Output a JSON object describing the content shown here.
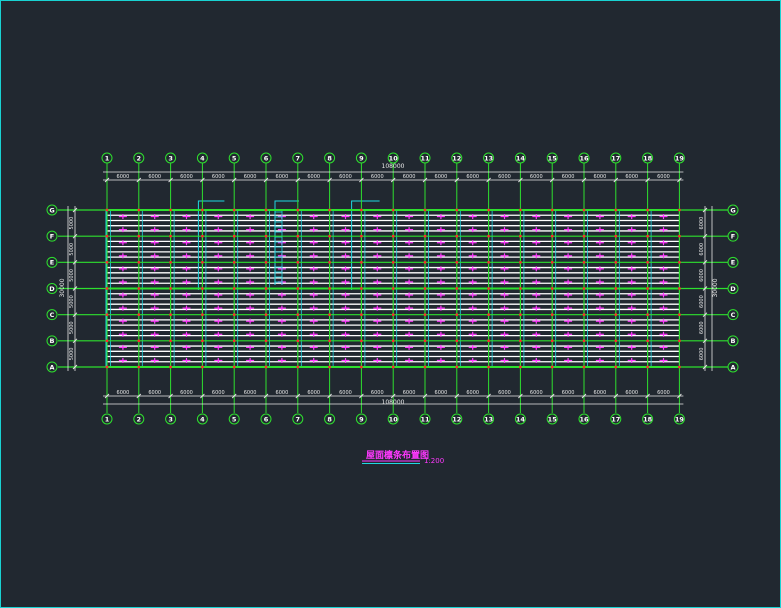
{
  "drawing": {
    "grid_x_labels": [
      "1",
      "2",
      "3",
      "4",
      "5",
      "6",
      "7",
      "8",
      "9",
      "10",
      "11",
      "12",
      "13",
      "14",
      "15",
      "16",
      "17",
      "18",
      "19"
    ],
    "grid_y_labels": [
      "G",
      "F",
      "E",
      "D",
      "C",
      "B",
      "A"
    ],
    "bay_spacing_labels": [
      "6000",
      "6000",
      "6000",
      "6000",
      "6000",
      "6000",
      "6000",
      "6000",
      "6000",
      "6000",
      "6000",
      "6000",
      "6000",
      "6000",
      "6000",
      "6000",
      "6000",
      "6000"
    ],
    "total_length_label": "108000",
    "span_labels_left": [
      "5000",
      "5000",
      "5000",
      "5000",
      "5000",
      "5000"
    ],
    "span_labels_right": [
      "6000",
      "6000",
      "6000",
      "6000",
      "6000",
      "6000"
    ],
    "total_width_label": "30000",
    "title": "屋面檩条布置图",
    "scale": "1:200"
  },
  "colors": {
    "background": "#212830",
    "frame": "#19d2d2",
    "grid_line": "#2ee02e",
    "dim_line": "#e8e8e8",
    "purlin": "#ffffff",
    "rafter": "#2ee02e",
    "bracing": "#ff38ff",
    "cyan_member": "#1fd7e0",
    "title_text": "#ff38ff",
    "column_dot": "#ff2a2a"
  }
}
